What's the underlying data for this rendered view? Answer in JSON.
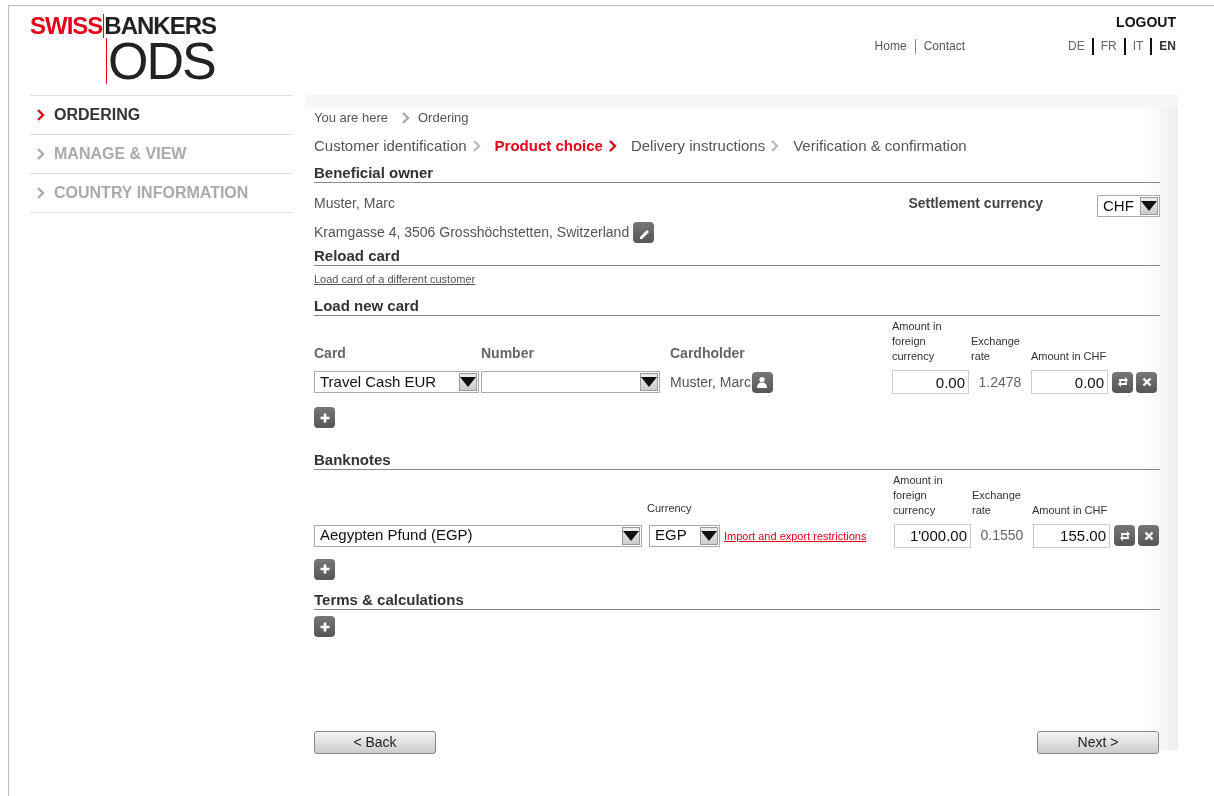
{
  "logo": {
    "brand_left": "SWISS",
    "brand_right": "BANKERS",
    "product": "ODS"
  },
  "header": {
    "logout": "LOGOUT",
    "links": [
      "Home",
      "Contact"
    ],
    "languages": [
      {
        "label": "DE",
        "selected": false
      },
      {
        "label": "FR",
        "selected": false
      },
      {
        "label": "IT",
        "selected": false
      },
      {
        "label": "EN",
        "selected": true
      }
    ]
  },
  "sidebar": {
    "items": [
      {
        "label": "ORDERING",
        "selected": true
      },
      {
        "label": "MANAGE & VIEW",
        "selected": false
      },
      {
        "label": "COUNTRY INFORMATION",
        "selected": false
      }
    ]
  },
  "breadcrumb": {
    "label": "You are here",
    "items": [
      "Ordering"
    ]
  },
  "steps": [
    {
      "label": "Customer identification",
      "selected": false
    },
    {
      "label": "Product choice",
      "selected": true
    },
    {
      "label": "Delivery instructions",
      "selected": false
    },
    {
      "label": "Verification & confirmation",
      "selected": false
    }
  ],
  "beneficial_owner": {
    "title": "Beneficial owner",
    "name": "Muster, Marc",
    "address": "Kramgasse 4, 3506 Grosshöchstetten, Switzerland",
    "settlement_currency": {
      "label": "Settlement currency",
      "value": "CHF"
    }
  },
  "reload_card": {
    "title": "Reload card",
    "link": "Load card of a different customer"
  },
  "load_new_card": {
    "title": "Load new card",
    "columns": [
      "Card",
      "Number",
      "Cardholder",
      "Amount in foreign currency",
      "Exchange rate",
      "Amount in CHF"
    ],
    "rows": [
      {
        "card": "Travel Cash EUR",
        "cardholder": "Muster, Marc",
        "amount_foreign": "0.00",
        "rate": "1.2478",
        "amount_chf": "0.00"
      }
    ]
  },
  "banknotes": {
    "title": "Banknotes",
    "columns": [
      "Currency",
      "Amount in foreign currency",
      "Exchange rate",
      "Amount in CHF"
    ],
    "rows": [
      {
        "country": "Aegypten Pfund (EGP)",
        "currency": "EGP",
        "link": "Import and export restrictions",
        "amount_foreign": "1'000.00",
        "rate": "0.1550",
        "amount_chf": "155.00"
      }
    ]
  },
  "terms": {
    "title": "Terms & calculations"
  },
  "buttons": {
    "back": "< Back",
    "next": "Next >"
  }
}
